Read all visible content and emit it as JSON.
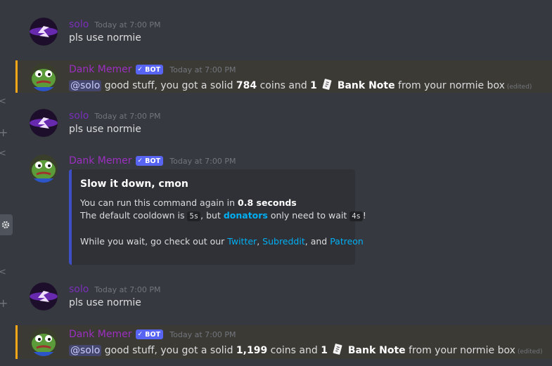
{
  "colors": {
    "background": "#36393f",
    "mention_bar": "#faa81a",
    "link": "#00aff4",
    "embed_border": "#3e4fc6",
    "bot_tag": "#5865f2"
  },
  "messages": [
    {
      "author": "solo",
      "time": "Today at 7:00 PM",
      "text": "pls use normie"
    },
    {
      "author": "Dank Memer",
      "bot_label": "BOT",
      "time": "Today at 7:00 PM",
      "mention": "@solo",
      "pre": " good stuff, you got a solid ",
      "coins": "784",
      "mid": " coins and ",
      "count": "1",
      "item": "Bank Note",
      "post": " from your normie box",
      "edited": "(edited)"
    },
    {
      "author": "solo",
      "time": "Today at 7:00 PM",
      "text": "pls use normie"
    },
    {
      "author": "Dank Memer",
      "bot_label": "BOT",
      "time": "Today at 7:00 PM",
      "embed": {
        "title": "Slow it down, cmon",
        "line1_pre": "You can run this command again in ",
        "line1_bold": "0.8 seconds",
        "line2_pre": "The default cooldown is ",
        "line2_code1": "5s",
        "line2_mid": ", but ",
        "line2_link": "donators",
        "line2_mid2": " only need to wait ",
        "line2_code2": "4s",
        "line2_end": "!",
        "line3_pre": "While you wait, go check out our ",
        "link_twitter": "Twitter",
        "sep1": ", ",
        "link_subreddit": "Subreddit",
        "sep2": ", and ",
        "link_patreon": "Patreon"
      }
    },
    {
      "author": "solo",
      "time": "Today at 7:00 PM",
      "text": "pls use normie"
    },
    {
      "author": "Dank Memer",
      "bot_label": "BOT",
      "time": "Today at 7:00 PM",
      "mention": "@solo",
      "pre": " good stuff, you got a solid ",
      "coins": "1,199",
      "mid": " coins and ",
      "count": "1",
      "item": "Bank Note",
      "post": " from your normie box",
      "edited": "(edited)"
    }
  ]
}
